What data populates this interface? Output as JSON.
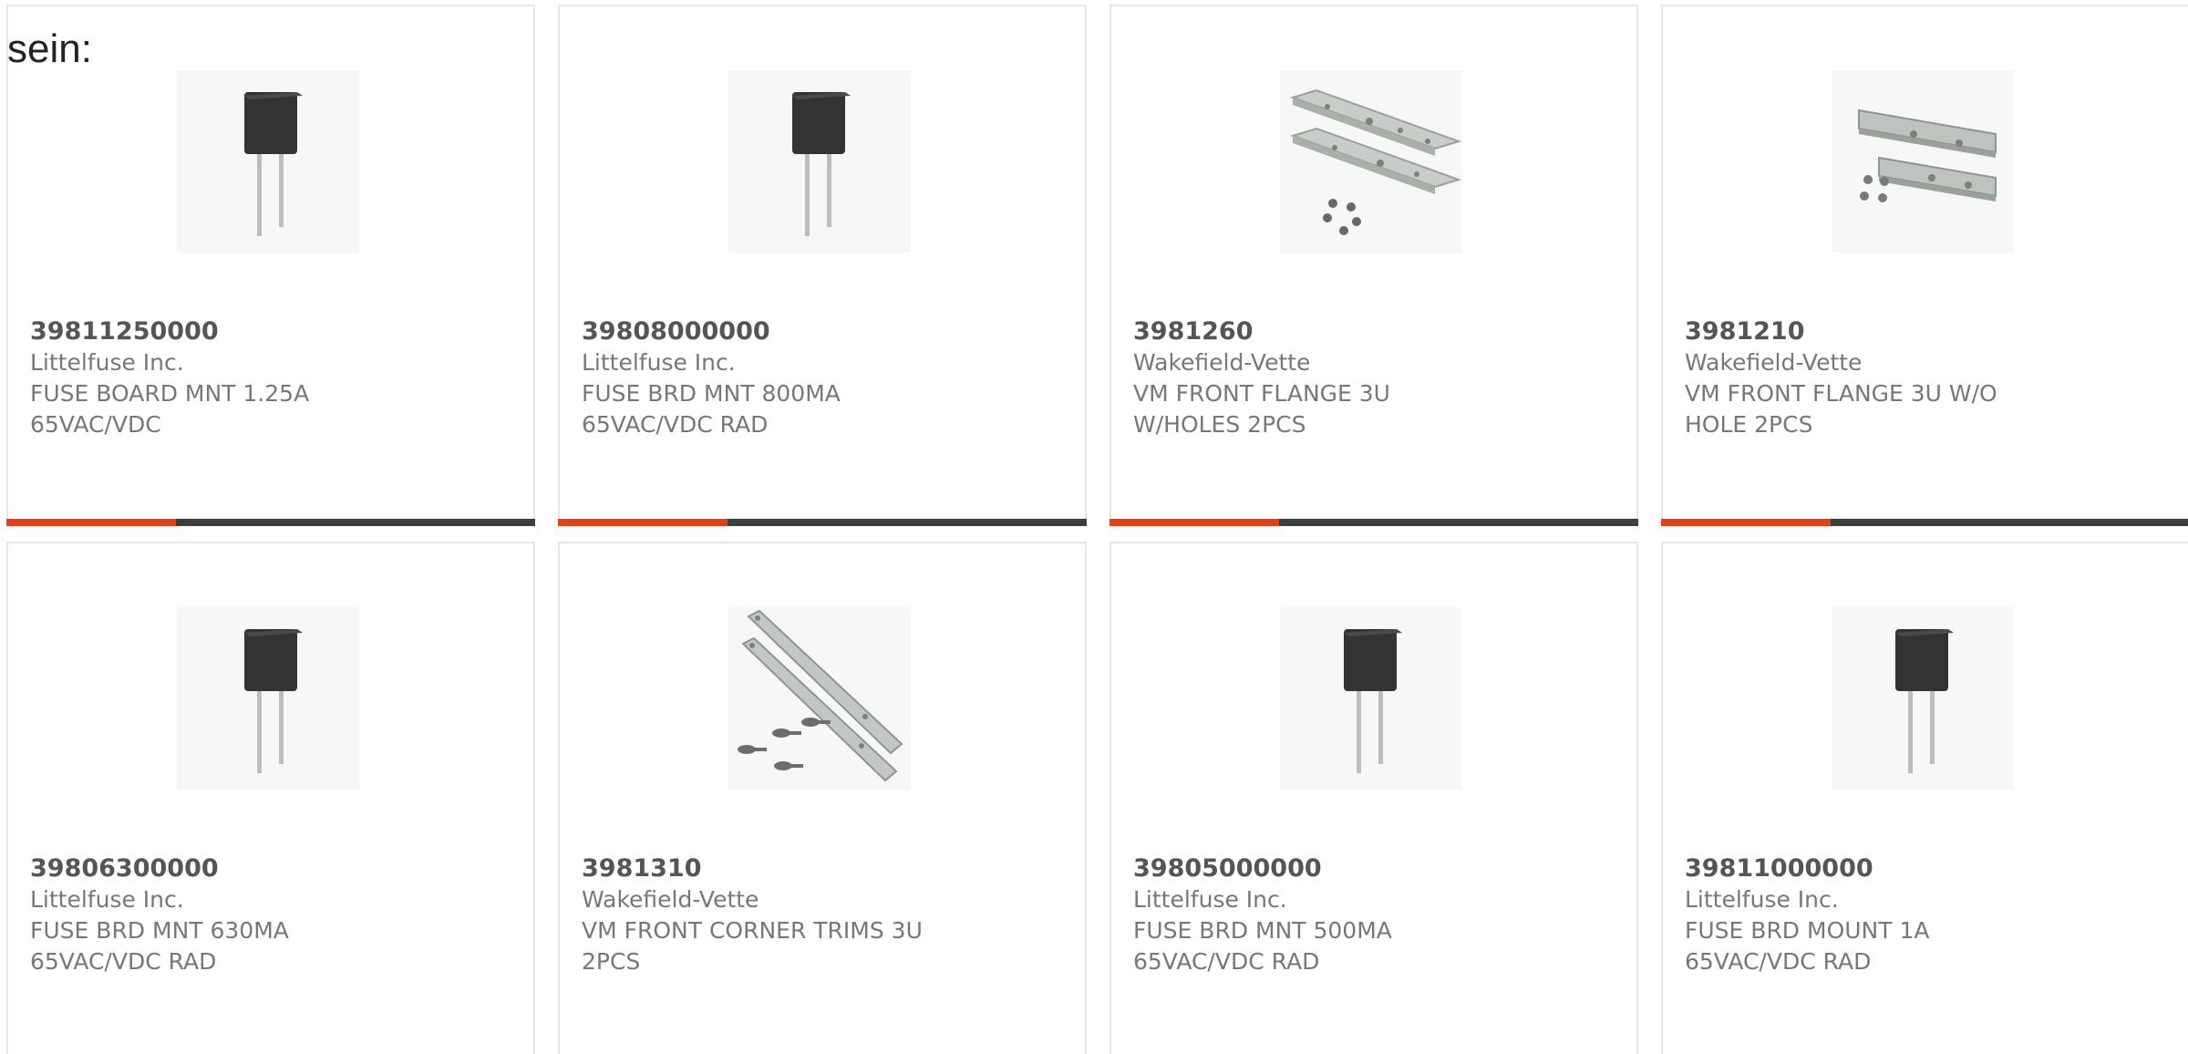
{
  "intro_text": "sein:",
  "colors": {
    "accent": "#e53f17",
    "bar_track": "#3d3d3d",
    "border": "#e6e6e6",
    "text": "#777777"
  },
  "products": [
    {
      "part_number": "39811250000",
      "manufacturer": "Littelfuse Inc.",
      "description": "FUSE BOARD MNT 1.25A 65VAC/VDC",
      "image_icon": "fuse-radial-icon"
    },
    {
      "part_number": "39808000000",
      "manufacturer": "Littelfuse Inc.",
      "description": "FUSE BRD MNT 800MA 65VAC/VDC RAD",
      "image_icon": "fuse-radial-icon"
    },
    {
      "part_number": "3981260",
      "manufacturer": "Wakefield-Vette",
      "description": "VM FRONT FLANGE 3U W/HOLES 2PCS",
      "image_icon": "flange-with-holes-icon"
    },
    {
      "part_number": "3981210",
      "manufacturer": "Wakefield-Vette",
      "description": "VM FRONT FLANGE 3U W/O HOLE 2PCS",
      "image_icon": "flange-no-holes-icon"
    },
    {
      "part_number": "39806300000",
      "manufacturer": "Littelfuse Inc.",
      "description": "FUSE BRD MNT 630MA 65VAC/VDC RAD",
      "image_icon": "fuse-radial-icon"
    },
    {
      "part_number": "3981310",
      "manufacturer": "Wakefield-Vette",
      "description": "VM FRONT CORNER TRIMS 3U 2PCS",
      "image_icon": "corner-trims-icon"
    },
    {
      "part_number": "39805000000",
      "manufacturer": "Littelfuse Inc.",
      "description": "FUSE BRD MNT 500MA 65VAC/VDC RAD",
      "image_icon": "fuse-radial-icon"
    },
    {
      "part_number": "39811000000",
      "manufacturer": "Littelfuse Inc.",
      "description": "FUSE BRD MOUNT 1A 65VAC/VDC RAD",
      "image_icon": "fuse-radial-icon"
    }
  ]
}
